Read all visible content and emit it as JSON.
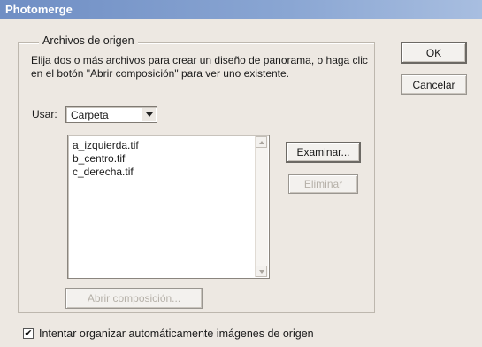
{
  "window": {
    "title": "Photomerge"
  },
  "source_files": {
    "group_label": "Archivos de origen",
    "description": "Elija dos o más archivos para crear un diseño de panorama, o haga clic en el botón \"Abrir composición\" para ver uno existente.",
    "use_label": "Usar:",
    "use_value": "Carpeta",
    "files": [
      "a_izquierda.tif",
      "b_centro.tif",
      "c_derecha.tif"
    ],
    "browse_label": "Examinar...",
    "remove_label": "Eliminar",
    "open_composition_label": "Abrir composición..."
  },
  "buttons": {
    "ok_label": "OK",
    "cancel_label": "Cancelar"
  },
  "auto_arrange": {
    "checked": true,
    "check_mark": "✔",
    "label": "Intentar organizar automáticamente imágenes de origen"
  }
}
